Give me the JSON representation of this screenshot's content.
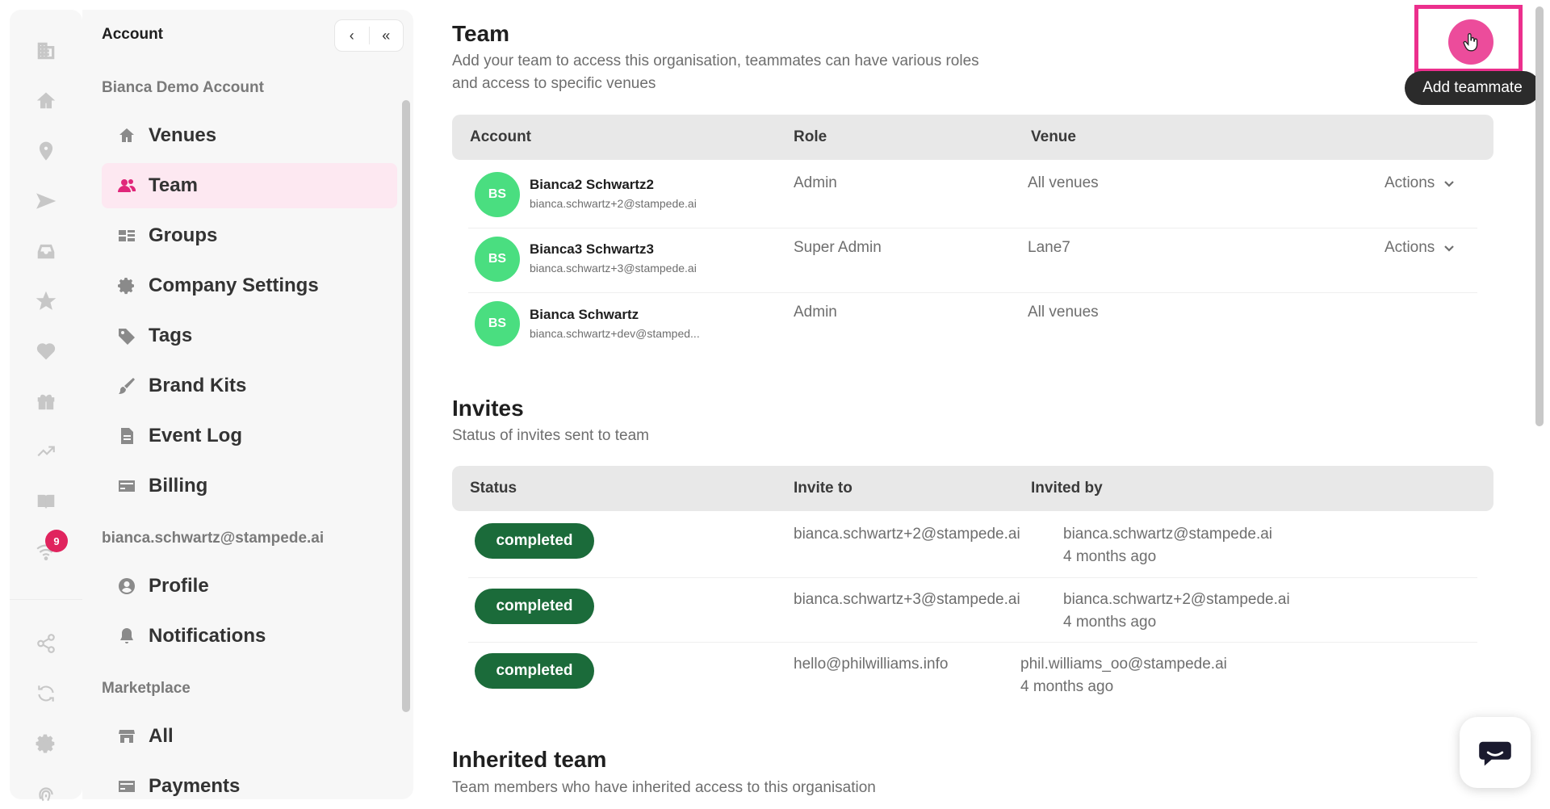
{
  "sidebar": {
    "header": "Account",
    "collapse_left": "‹",
    "collapse_all": "«",
    "org_label": "Bianca Demo Account",
    "org_items": [
      {
        "label": "Venues",
        "icon": "home-icon"
      },
      {
        "label": "Team",
        "icon": "users-icon"
      },
      {
        "label": "Groups",
        "icon": "groups-icon"
      },
      {
        "label": "Company Settings",
        "icon": "gear-icon"
      },
      {
        "label": "Tags",
        "icon": "tag-icon"
      },
      {
        "label": "Brand Kits",
        "icon": "brush-icon"
      },
      {
        "label": "Event Log",
        "icon": "document-icon"
      },
      {
        "label": "Billing",
        "icon": "card-icon"
      }
    ],
    "user_label": "bianca.schwartz@stampede.ai",
    "user_items": [
      {
        "label": "Profile",
        "icon": "user-circle-icon"
      },
      {
        "label": "Notifications",
        "icon": "bell-icon"
      }
    ],
    "market_label": "Marketplace",
    "market_items": [
      {
        "label": "All",
        "icon": "store-icon"
      },
      {
        "label": "Payments",
        "icon": "card-icon"
      }
    ],
    "active": "Team"
  },
  "rail": {
    "notification_count": "9"
  },
  "team": {
    "title": "Team",
    "description_line1": "Add your team to access this organisation, teammates can have various roles",
    "description_line2": "and access to specific venues",
    "columns": [
      "Account",
      "Role",
      "Venue"
    ],
    "rows": [
      {
        "initials": "BS",
        "name": "Bianca2 Schwartz2",
        "email": "bianca.schwartz+2@stampede.ai",
        "role": "Admin",
        "venue": "All venues",
        "actions": "Actions"
      },
      {
        "initials": "BS",
        "name": "Bianca3 Schwartz3",
        "email": "bianca.schwartz+3@stampede.ai",
        "role": "Super Admin",
        "venue": "Lane7",
        "actions": "Actions"
      },
      {
        "initials": "BS",
        "name": "Bianca Schwartz",
        "email": "bianca.schwartz+dev@stamped...",
        "role": "Admin",
        "venue": "All venues",
        "actions": ""
      }
    ]
  },
  "invites": {
    "title": "Invites",
    "description": "Status of invites sent to team",
    "columns": [
      "Status",
      "Invite to",
      "Invited by"
    ],
    "rows": [
      {
        "status": "completed",
        "invite_to": "bianca.schwartz+2@stampede.ai",
        "invited_by": "bianca.schwartz@stampede.ai",
        "when": "4 months ago"
      },
      {
        "status": "completed",
        "invite_to": "bianca.schwartz+3@stampede.ai",
        "invited_by": "bianca.schwartz+2@stampede.ai",
        "when": "4 months ago"
      },
      {
        "status": "completed",
        "invite_to": "hello@philwilliams.info",
        "invited_by": "phil.williams_oo@stampede.ai",
        "when": "4 months ago"
      }
    ]
  },
  "inherited": {
    "title": "Inherited team",
    "description": "Team members who have inherited access to this organisation"
  },
  "add_teammate": {
    "tooltip": "Add teammate"
  },
  "colors": {
    "accent": "#ec4c9b",
    "highlight": "#ec2f8d",
    "avatar": "#4ade80",
    "status_completed": "#1b6b3a",
    "active_nav_bg": "#fde8f1"
  }
}
